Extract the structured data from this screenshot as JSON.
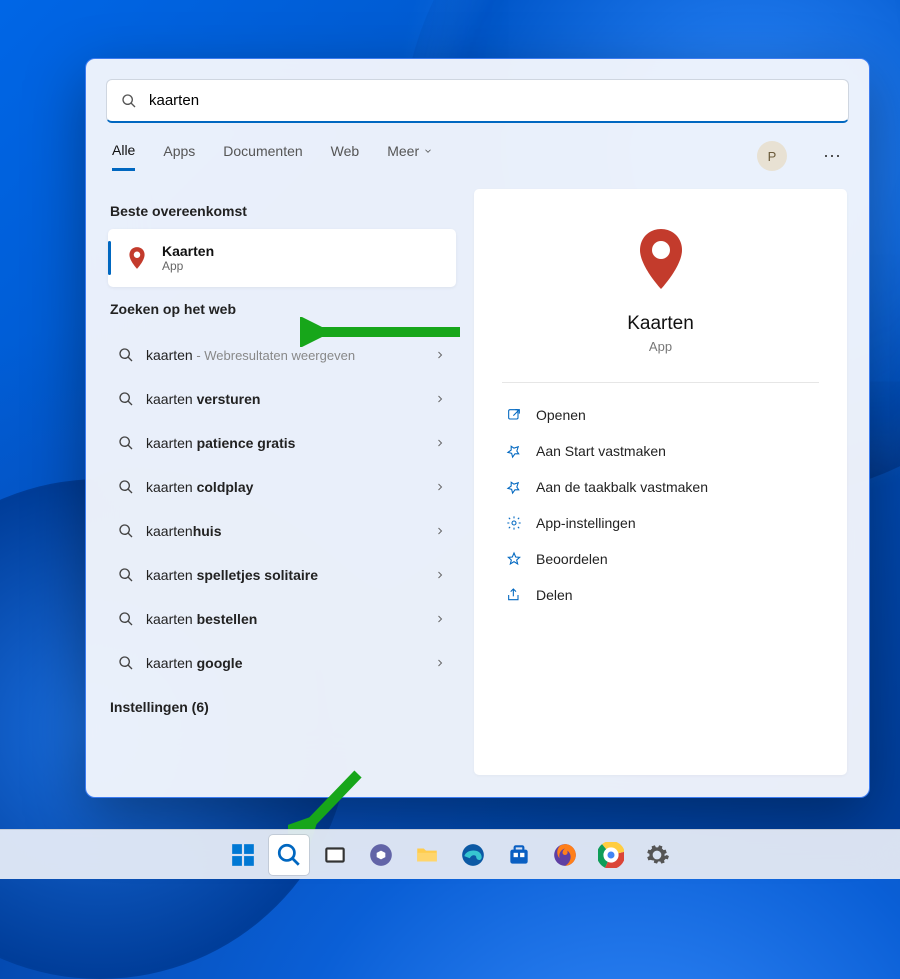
{
  "search": {
    "value": "kaarten"
  },
  "tabs": [
    "Alle",
    "Apps",
    "Documenten",
    "Web",
    "Meer"
  ],
  "activeTab": 0,
  "avatarInitial": "P",
  "sections": {
    "bestMatch": "Beste overeenkomst",
    "web": "Zoeken op het web",
    "settings": "Instellingen  (6)"
  },
  "bestMatch": {
    "title": "Kaarten",
    "subtitle": "App"
  },
  "webResults": [
    {
      "prefix": "kaarten",
      "bold": "",
      "suffix": " - Webresultaten weergeven",
      "suffixClass": "sub"
    },
    {
      "prefix": "kaarten ",
      "bold": "versturen"
    },
    {
      "prefix": "kaarten ",
      "bold": "patience gratis"
    },
    {
      "prefix": "kaarten ",
      "bold": "coldplay"
    },
    {
      "prefix": "kaarten",
      "bold": "huis"
    },
    {
      "prefix": "kaarten ",
      "bold": "spelletjes solitaire"
    },
    {
      "prefix": "kaarten ",
      "bold": "bestellen"
    },
    {
      "prefix": "kaarten ",
      "bold": "google"
    }
  ],
  "preview": {
    "title": "Kaarten",
    "subtitle": "App"
  },
  "actions": [
    {
      "icon": "open",
      "label": "Openen"
    },
    {
      "icon": "pin",
      "label": "Aan Start vastmaken"
    },
    {
      "icon": "pin",
      "label": "Aan de taakbalk vastmaken"
    },
    {
      "icon": "gear",
      "label": "App-instellingen"
    },
    {
      "icon": "star",
      "label": "Beoordelen"
    },
    {
      "icon": "share",
      "label": "Delen"
    }
  ],
  "taskbar": [
    "start",
    "search",
    "taskview",
    "chat",
    "explorer",
    "edge",
    "store",
    "firefox",
    "chrome",
    "settings"
  ]
}
